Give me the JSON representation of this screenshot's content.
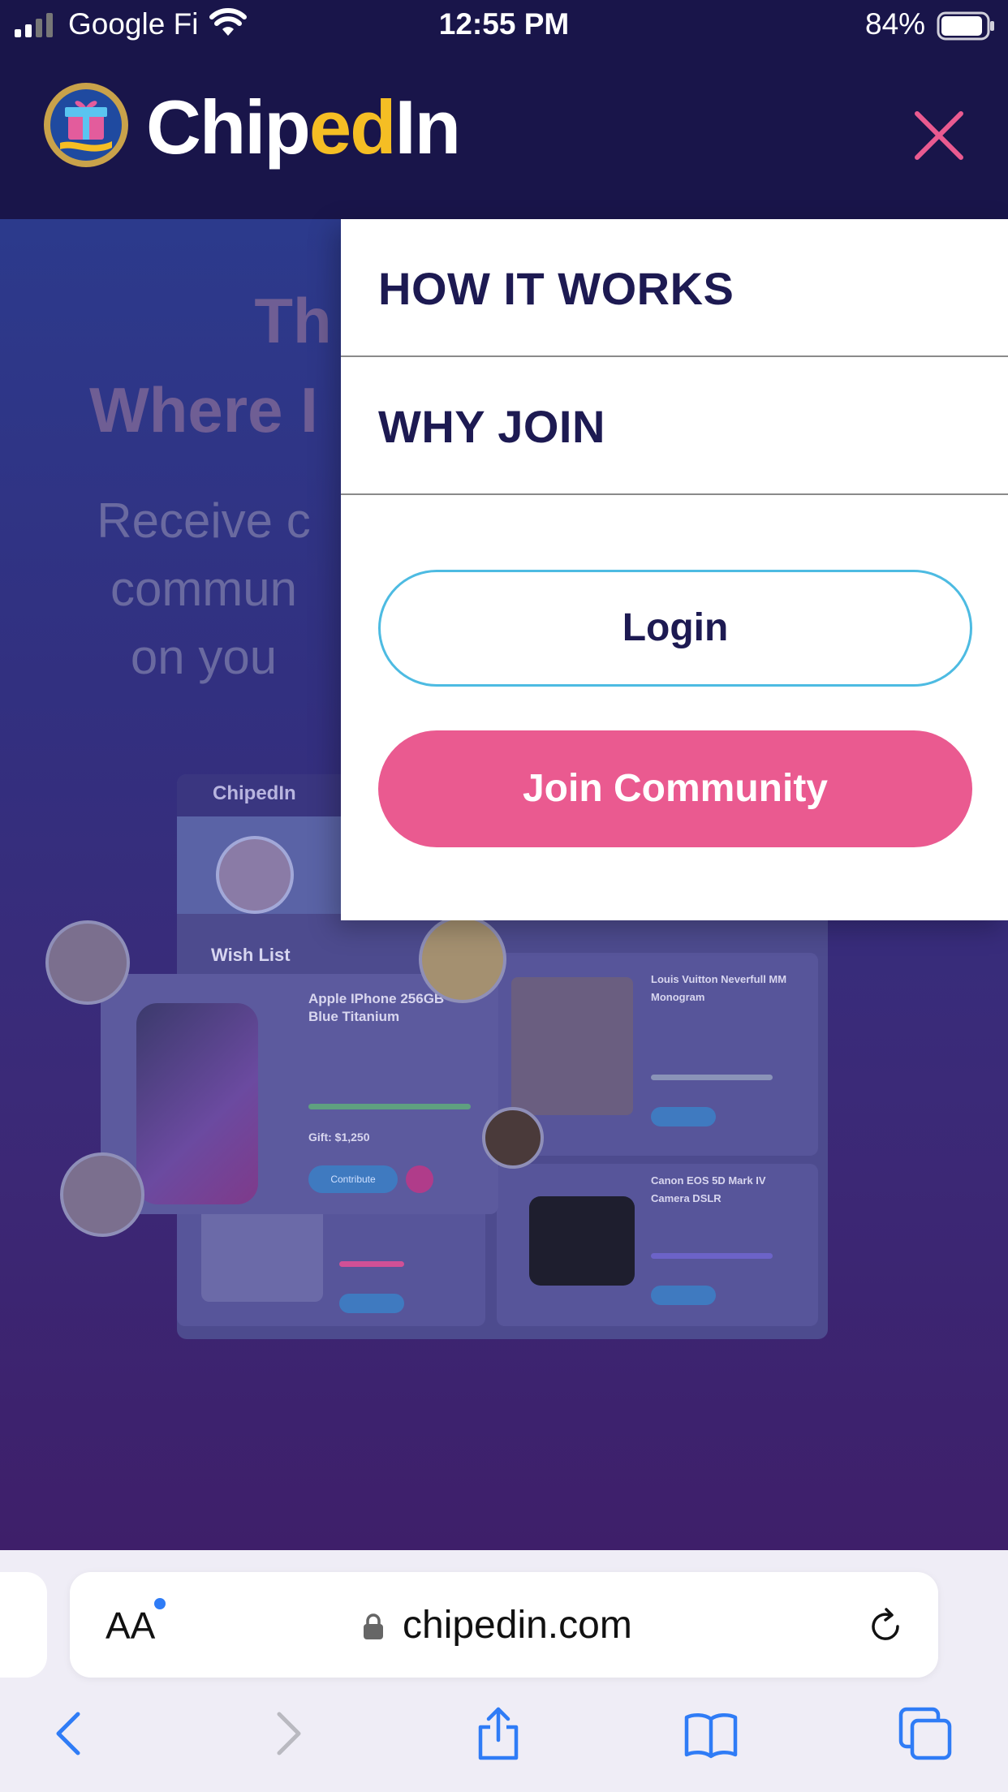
{
  "status_bar": {
    "carrier": "Google Fi",
    "time": "12:55 PM",
    "battery_percent": "84%"
  },
  "header": {
    "brand_part1": "Chip",
    "brand_part2": "ed",
    "brand_part3": "In",
    "close_icon": "close-icon",
    "accent_color": "#ea5a90",
    "brand_color": "#f5be24"
  },
  "hero": {
    "title_line1": "Th",
    "title_line2": "Where I",
    "subtitle_line1": "Receive c",
    "subtitle_line2": "commun",
    "subtitle_line3": "on you"
  },
  "mockup": {
    "brand": "ChipedIn",
    "wish_list_title": "Wish List",
    "items": [
      {
        "name": "Apple IPhone 256GB Blue Titanium"
      },
      {
        "name": "Louis Vuitton Neverfull MM Monogram"
      },
      {
        "name": "Canon EOS 5D Mark IV Camera DSLR"
      }
    ],
    "gift_1": "Gift: $1,250",
    "button_contribute": "Contribute"
  },
  "menu": {
    "items": [
      {
        "label": "HOW IT WORKS"
      },
      {
        "label": "WHY JOIN"
      }
    ],
    "login_label": "Login",
    "join_label": "Join Community"
  },
  "safari": {
    "aa_label": "AA",
    "url": "chipedin.com",
    "toolbar_icons": [
      "back-icon",
      "forward-icon",
      "share-icon",
      "bookmarks-icon",
      "tabs-icon"
    ]
  }
}
